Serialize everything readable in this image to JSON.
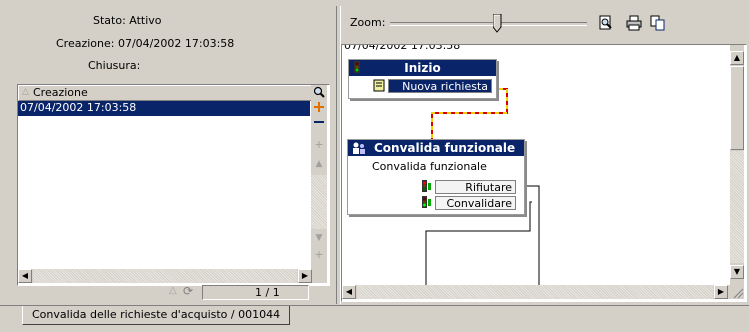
{
  "info": {
    "stato": "Stato: Attivo",
    "creazione": "Creazione: 07/04/2002 17:03:58",
    "chiusura": "Chiusura:"
  },
  "list": {
    "column_header": "Creazione",
    "rows": [
      "07/04/2002 17:03:58"
    ],
    "page_indicator": "1 / 1"
  },
  "zoom": {
    "label": "Zoom:",
    "level": 0.55
  },
  "canvas": {
    "top_timestamp": "07/04/2002 17:03:58",
    "nodes": {
      "start": {
        "title": "Inizio",
        "outputs": [
          "Nuova richiesta"
        ]
      },
      "validation": {
        "title": "Convalida funzionale",
        "description": "Convalida funzionale",
        "outputs": [
          "Rifiutare",
          "Convalidare"
        ]
      }
    }
  },
  "tab": {
    "label": "Convalida delle richieste d'acquisto / 001044"
  },
  "colors": {
    "selection": "#0a246a",
    "window": "#d4d0c8",
    "link_dash": "#e8c800",
    "link_red": "#d40000"
  }
}
